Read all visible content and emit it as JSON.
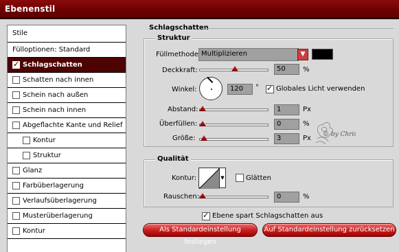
{
  "window": {
    "title": "Ebenenstil"
  },
  "left": {
    "header": "Stile",
    "items": [
      {
        "label": "Fülloptionen: Standard",
        "checkbox": false,
        "checked": false,
        "selected": false,
        "indent": false
      },
      {
        "label": "Schlagschatten",
        "checkbox": true,
        "checked": true,
        "selected": true,
        "indent": false
      },
      {
        "label": "Schatten nach innen",
        "checkbox": true,
        "checked": false,
        "selected": false,
        "indent": false
      },
      {
        "label": "Schein nach außen",
        "checkbox": true,
        "checked": false,
        "selected": false,
        "indent": false
      },
      {
        "label": "Schein nach innen",
        "checkbox": true,
        "checked": false,
        "selected": false,
        "indent": false
      },
      {
        "label": "Abgeflachte Kante und Relief",
        "checkbox": true,
        "checked": false,
        "selected": false,
        "indent": false
      },
      {
        "label": "Kontur",
        "checkbox": true,
        "checked": false,
        "selected": false,
        "indent": true
      },
      {
        "label": "Struktur",
        "checkbox": true,
        "checked": false,
        "selected": false,
        "indent": true
      },
      {
        "label": "Glanz",
        "checkbox": true,
        "checked": false,
        "selected": false,
        "indent": false
      },
      {
        "label": "Farbüberlagerung",
        "checkbox": true,
        "checked": false,
        "selected": false,
        "indent": false
      },
      {
        "label": "Verlaufsüberlagerung",
        "checkbox": true,
        "checked": false,
        "selected": false,
        "indent": false
      },
      {
        "label": "Musterüberlagerung",
        "checkbox": true,
        "checked": false,
        "selected": false,
        "indent": false
      },
      {
        "label": "Kontur",
        "checkbox": true,
        "checked": false,
        "selected": false,
        "indent": false
      }
    ]
  },
  "panel": {
    "title": "Schlagschatten",
    "structure": {
      "title": "Struktur",
      "blend_label": "Füllmethode:",
      "blend_value": "Multiplizieren",
      "shadow_color": "#000000",
      "opacity_label": "Deckkraft:",
      "opacity_value": "50",
      "opacity_unit": "%",
      "opacity_level": 0.5,
      "angle_label": "Winkel:",
      "angle_value": "120",
      "angle_unit": "°",
      "global_light_label": "Globales Licht verwenden",
      "global_light_checked": true,
      "distance_label": "Abstand:",
      "distance_value": "1",
      "distance_unit": "Px",
      "spread_label": "Überfüllen:",
      "spread_value": "0",
      "spread_unit": "%",
      "size_label": "Größe:",
      "size_value": "3",
      "size_unit": "Px"
    },
    "quality": {
      "title": "Qualität",
      "contour_label": "Kontur:",
      "antialias_label": "Glätten",
      "antialias_checked": false,
      "noise_label": "Rauschen:",
      "noise_value": "0",
      "noise_unit": "%"
    },
    "knockout_label": "Ebene spart Schlagschatten aus",
    "knockout_checked": true,
    "btn_set_default": "Als Standardeinstellung festlegen",
    "btn_reset_default": "Auf Standardeinstellung zurücksetzen"
  },
  "watermark": "© by Christa",
  "colors": {
    "title_bar": "#6a0000",
    "selected_row": "#4e0303",
    "accent": "#c31d1d"
  }
}
